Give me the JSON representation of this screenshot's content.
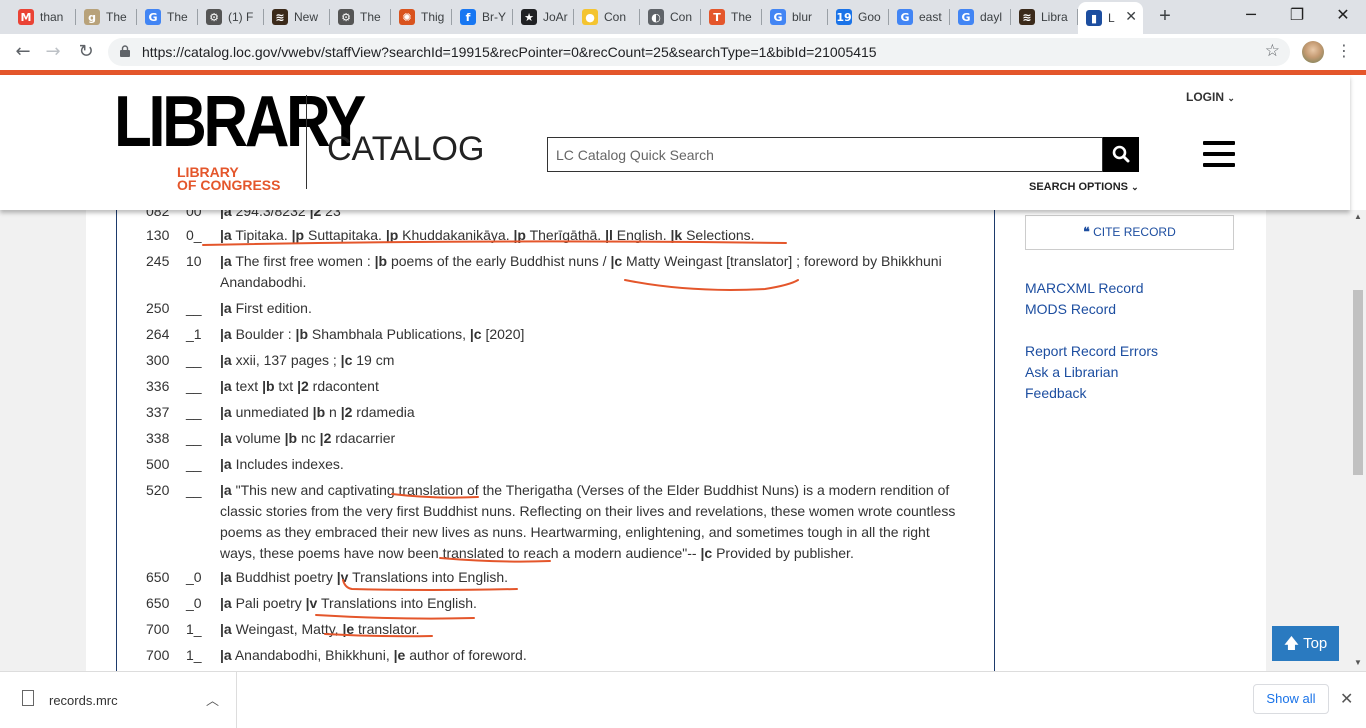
{
  "browser": {
    "tabs": [
      {
        "icon": "gmail-icon",
        "label": "than",
        "color": "#ea4335",
        "glyph": "M"
      },
      {
        "icon": "goodreads-icon",
        "label": "The",
        "color": "#b8a27a",
        "glyph": "g"
      },
      {
        "icon": "google-icon",
        "label": "The",
        "color": "#4285f4",
        "glyph": "G"
      },
      {
        "icon": "gear-icon",
        "label": "(1) F",
        "color": "#555555",
        "glyph": "⚙"
      },
      {
        "icon": "site-icon",
        "label": "New",
        "color": "#3b2a1a",
        "glyph": "≋"
      },
      {
        "icon": "gear-icon",
        "label": "The",
        "color": "#555555",
        "glyph": "⚙"
      },
      {
        "icon": "sun-icon",
        "label": "Thig",
        "color": "#d9531e",
        "glyph": "✺"
      },
      {
        "icon": "facebook-icon",
        "label": "Br-Y",
        "color": "#1877f2",
        "glyph": "f"
      },
      {
        "icon": "star-icon",
        "label": "JoAr",
        "color": "#202124",
        "glyph": "★"
      },
      {
        "icon": "coin-icon",
        "label": "Con",
        "color": "#f4c430",
        "glyph": "●"
      },
      {
        "icon": "globe-icon",
        "label": "Con",
        "color": "#5f6368",
        "glyph": "◐"
      },
      {
        "icon": "t-icon",
        "label": "The",
        "color": "#e4562b",
        "glyph": "T"
      },
      {
        "icon": "google-icon",
        "label": "blur",
        "color": "#4285f4",
        "glyph": "G"
      },
      {
        "icon": "calendar-icon",
        "label": "Goo",
        "color": "#1a73e8",
        "glyph": "19"
      },
      {
        "icon": "google-icon",
        "label": "east",
        "color": "#4285f4",
        "glyph": "G"
      },
      {
        "icon": "google-icon",
        "label": "dayl",
        "color": "#4285f4",
        "glyph": "G"
      },
      {
        "icon": "site-icon",
        "label": "Libra",
        "color": "#3b2a1a",
        "glyph": "≋"
      },
      {
        "icon": "loc-icon",
        "label": "L",
        "color": "#1d4ea0",
        "glyph": "▮"
      }
    ],
    "url": "https://catalog.loc.gov/vwebv/staffView?searchId=19915&recPointer=0&recCount=25&searchType=1&bibId=21005415"
  },
  "header": {
    "logo_main": "LIBRARY",
    "logo_sub1": "LIBRARY",
    "logo_sub2": "OF CONGRESS",
    "catalog": "CATALOG",
    "login": "LOGIN",
    "search_placeholder": "LC Catalog Quick Search",
    "search_options": "SEARCH OPTIONS"
  },
  "marc": [
    {
      "tag": "082",
      "ind": "00",
      "val": "|a 294.3/8232 |2 23"
    },
    {
      "tag": "130",
      "ind": "0_",
      "val": "|a Tipitaka. |p Suttapitaka. |p Khuddakanikāya. |p Therīgāthā. |l English. |k Selections."
    },
    {
      "tag": "245",
      "ind": "10",
      "val": "|a The first free women : |b poems of the early Buddhist nuns / |c Matty Weingast [translator] ; foreword by Bhikkhuni Anandabodhi."
    },
    {
      "tag": "250",
      "ind": "__",
      "val": "|a First edition."
    },
    {
      "tag": "264",
      "ind": "_1",
      "val": "|a Boulder : |b Shambhala Publications, |c [2020]"
    },
    {
      "tag": "300",
      "ind": "__",
      "val": "|a xxii, 137 pages ; |c 19 cm"
    },
    {
      "tag": "336",
      "ind": "__",
      "val": "|a text |b txt |2 rdacontent"
    },
    {
      "tag": "337",
      "ind": "__",
      "val": "|a unmediated |b n |2 rdamedia"
    },
    {
      "tag": "338",
      "ind": "__",
      "val": "|a volume |b nc |2 rdacarrier"
    },
    {
      "tag": "500",
      "ind": "__",
      "val": "|a Includes indexes."
    },
    {
      "tag": "520",
      "ind": "__",
      "val": "|a \"This new and captivating translation of the Therigatha (Verses of the Elder Buddhist Nuns) is a modern rendition of classic stories from the very first Buddhist nuns. Reflecting on their lives and revelations, these women wrote countless poems as they embraced their new lives as nuns. Heartwarming, enlightening, and sometimes tough in all the right ways, these poems have now been translated to reach a modern audience\"-- |c Provided by publisher."
    },
    {
      "tag": "650",
      "ind": "_0",
      "val": "|a Buddhist poetry |v Translations into English."
    },
    {
      "tag": "650",
      "ind": "_0",
      "val": "|a Pali poetry |v Translations into English."
    },
    {
      "tag": "700",
      "ind": "1_",
      "val": "|a Weingast, Matty, |e translator."
    },
    {
      "tag": "700",
      "ind": "1_",
      "val": "|a Anandabodhi, Bhikkhuni, |e author of foreword."
    }
  ],
  "sidebar": {
    "cite": "CITE RECORD",
    "links": [
      "MARCXML Record",
      "MODS Record",
      "Report Record Errors",
      "Ask a Librarian",
      "Feedback"
    ]
  },
  "top_button": "Top",
  "downloads": {
    "file": "records.mrc",
    "show_all": "Show all"
  }
}
